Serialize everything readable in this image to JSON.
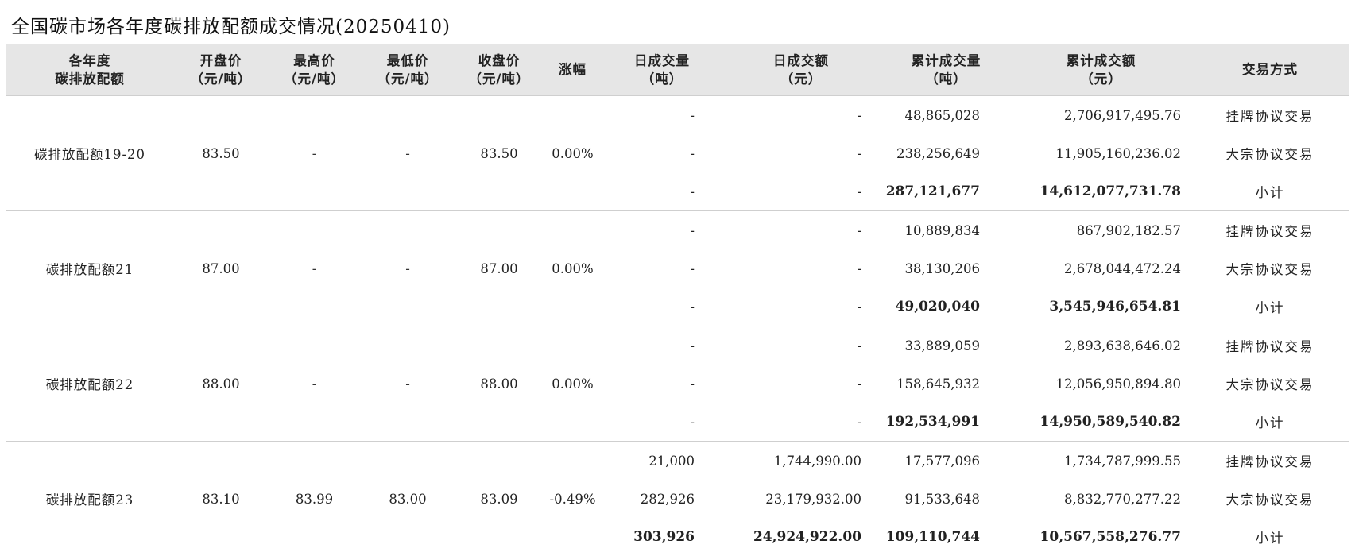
{
  "title": "全国碳市场各年度碳排放配额成交情况(20250410)",
  "headers": {
    "allowance": [
      "各年度",
      "碳排放配额"
    ],
    "open": [
      "开盘价",
      "（元/吨）"
    ],
    "high": [
      "最高价",
      "（元/吨）"
    ],
    "low": [
      "最低价",
      "（元/吨）"
    ],
    "close": [
      "收盘价",
      "（元/吨）"
    ],
    "change": [
      "涨幅"
    ],
    "daily_volume": [
      "日成交量",
      "（吨）"
    ],
    "daily_amount": [
      "日成交额",
      "（元）"
    ],
    "cum_volume": [
      "累计成交量",
      "（吨）"
    ],
    "cum_amount": [
      "累计成交额",
      "（元）"
    ],
    "method": [
      "交易方式"
    ]
  },
  "groups": [
    {
      "name": "碳排放配额19-20",
      "open": "83.50",
      "high": "-",
      "low": "-",
      "close": "83.50",
      "change": "0.00%",
      "rows": [
        {
          "daily_volume": "-",
          "daily_amount": "-",
          "cum_volume": "48,865,028",
          "cum_amount": "2,706,917,495.76",
          "method": "挂牌协议交易"
        },
        {
          "daily_volume": "-",
          "daily_amount": "-",
          "cum_volume": "238,256,649",
          "cum_amount": "11,905,160,236.02",
          "method": "大宗协议交易"
        },
        {
          "daily_volume": "-",
          "daily_amount": "-",
          "cum_volume": "287,121,677",
          "cum_amount": "14,612,077,731.78",
          "method": "小计"
        }
      ]
    },
    {
      "name": "碳排放配额21",
      "open": "87.00",
      "high": "-",
      "low": "-",
      "close": "87.00",
      "change": "0.00%",
      "rows": [
        {
          "daily_volume": "-",
          "daily_amount": "-",
          "cum_volume": "10,889,834",
          "cum_amount": "867,902,182.57",
          "method": "挂牌协议交易"
        },
        {
          "daily_volume": "-",
          "daily_amount": "-",
          "cum_volume": "38,130,206",
          "cum_amount": "2,678,044,472.24",
          "method": "大宗协议交易"
        },
        {
          "daily_volume": "-",
          "daily_amount": "-",
          "cum_volume": "49,020,040",
          "cum_amount": "3,545,946,654.81",
          "method": "小计"
        }
      ]
    },
    {
      "name": "碳排放配额22",
      "open": "88.00",
      "high": "-",
      "low": "-",
      "close": "88.00",
      "change": "0.00%",
      "rows": [
        {
          "daily_volume": "-",
          "daily_amount": "-",
          "cum_volume": "33,889,059",
          "cum_amount": "2,893,638,646.02",
          "method": "挂牌协议交易"
        },
        {
          "daily_volume": "-",
          "daily_amount": "-",
          "cum_volume": "158,645,932",
          "cum_amount": "12,056,950,894.80",
          "method": "大宗协议交易"
        },
        {
          "daily_volume": "-",
          "daily_amount": "-",
          "cum_volume": "192,534,991",
          "cum_amount": "14,950,589,540.82",
          "method": "小计"
        }
      ]
    },
    {
      "name": "碳排放配额23",
      "open": "83.10",
      "high": "83.99",
      "low": "83.00",
      "close": "83.09",
      "change": "-0.49%",
      "rows": [
        {
          "daily_volume": "21,000",
          "daily_amount": "1,744,990.00",
          "cum_volume": "17,577,096",
          "cum_amount": "1,734,787,999.55",
          "method": "挂牌协议交易"
        },
        {
          "daily_volume": "282,926",
          "daily_amount": "23,179,932.00",
          "cum_volume": "91,533,648",
          "cum_amount": "8,832,770,277.22",
          "method": "大宗协议交易"
        },
        {
          "daily_volume": "303,926",
          "daily_amount": "24,924,922.00",
          "cum_volume": "109,110,744",
          "cum_amount": "10,567,558,276.77",
          "method": "小计"
        }
      ]
    }
  ]
}
